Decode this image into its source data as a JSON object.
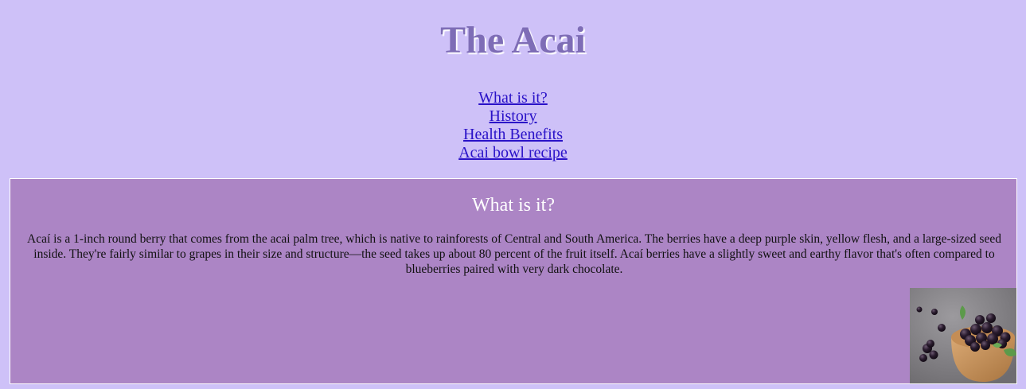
{
  "page": {
    "title": "The Acai"
  },
  "nav": {
    "items": [
      {
        "label": "What is it?"
      },
      {
        "label": "History"
      },
      {
        "label": "Health Benefits"
      },
      {
        "label": "Acai bowl recipe"
      }
    ]
  },
  "section": {
    "title": "What is it?",
    "paragraph": "Acaí is a 1-inch round berry that comes from the acai palm tree, which is native to rainforests of Central and South America. The berries have a deep purple skin, yellow flesh, and a large-sized seed inside. They're fairly similar to grapes in their size and structure—the seed takes up about 80 percent of the fruit itself. Acaí berries have a slightly sweet and earthy flavor that's often compared to blueberries paired with very dark chocolate.",
    "image": {
      "icon": "acai-bowl-photo"
    }
  },
  "colors": {
    "background": "#cec1f8",
    "title": "#7e6db6",
    "section_background": "#ac85c5",
    "link": "#2a12c8"
  }
}
